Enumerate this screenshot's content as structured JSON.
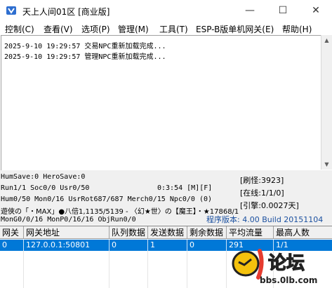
{
  "window": {
    "title": "天上人间01区 [商业版]",
    "controls": {
      "minimize": "—",
      "maximize": "☐",
      "close": "✕"
    }
  },
  "menu": [
    {
      "label": "控制(C)"
    },
    {
      "label": "查看(V)"
    },
    {
      "label": "选项(P)"
    },
    {
      "label": "管理(M)"
    },
    {
      "label": "工具(T)"
    },
    {
      "label": "ESP-B版单机网关(E)"
    },
    {
      "label": "帮助(H)"
    }
  ],
  "log": [
    "2025-9-10 19:29:57 交易NPC重新加载完成...",
    "2025-9-10 19:29:57 管理NPC重新加载完成..."
  ],
  "status": {
    "line1": "HumSave:0 HeroSave:0",
    "line2": "Run1/1 Soc0/0 Usr0/50",
    "time": "0:3:54 [M][F]",
    "line3": "Hum0/50 Mon0/16 UsrRot687/687 Merch0/15 Npc0/0 (0)",
    "line4": "遊俠の「・MAX」●八倍1,1135/5139 - 〈幻★世〉の【魔王】・★17868/1",
    "line5": "MonG0/0/16 MonP0/16/16 ObjRun0/0",
    "refresh_monster": "[刷怪:3923]",
    "online": "[在线:1/1/0]",
    "engine": "[引擎:0.0027天]",
    "version": "程序版本: 4.00 Build 20151104"
  },
  "table": {
    "headers": [
      "网关",
      "网关地址",
      "队列数据",
      "发送数据",
      "剩余数据",
      "平均流量",
      "最高人数"
    ],
    "rows": [
      [
        "0",
        "127.0.0.1:50801",
        "0",
        "1",
        "0",
        "291",
        "1/1"
      ]
    ]
  },
  "watermark": {
    "text": "论坛",
    "url": "bbs.0lb.com"
  }
}
